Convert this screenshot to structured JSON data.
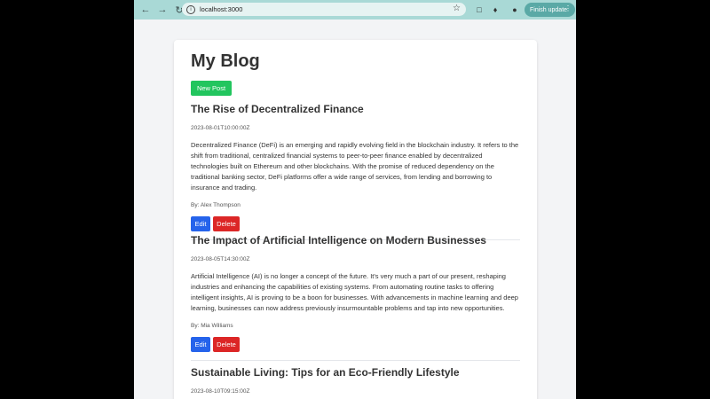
{
  "browser": {
    "url": "localhost:3000",
    "finish_update_label": "Finish update"
  },
  "blog": {
    "title": "My Blog",
    "new_post_label": "New Post",
    "edit_label": "Edit",
    "delete_label": "Delete",
    "posts": [
      {
        "title": "The Rise of Decentralized Finance",
        "date": "2023-08-01T10:00:00Z",
        "content": "Decentralized Finance (DeFi) is an emerging and rapidly evolving field in the blockchain industry. It refers to the shift from traditional, centralized financial systems to peer-to-peer finance enabled by decentralized technologies built on Ethereum and other blockchains. With the promise of reduced dependency on the traditional banking sector, DeFi platforms offer a wide range of services, from lending and borrowing to insurance and trading.",
        "author": "By: Alex Thompson"
      },
      {
        "title": "The Impact of Artificial Intelligence on Modern Businesses",
        "date": "2023-08-05T14:30:00Z",
        "content": "Artificial Intelligence (AI) is no longer a concept of the future. It's very much a part of our present, reshaping industries and enhancing the capabilities of existing systems. From automating routine tasks to offering intelligent insights, AI is proving to be a boon for businesses. With advancements in machine learning and deep learning, businesses can now address previously insurmountable problems and tap into new opportunities.",
        "author": "By: Mia Williams"
      },
      {
        "title": "Sustainable Living: Tips for an Eco-Friendly Lifestyle",
        "date": "2023-08-10T09:15:00Z"
      }
    ]
  }
}
